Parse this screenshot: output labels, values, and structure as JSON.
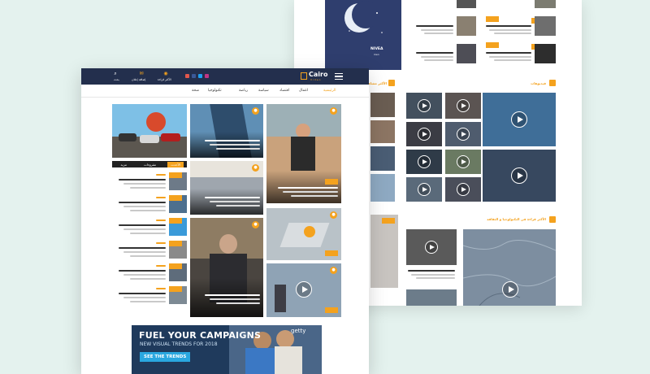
{
  "front": {
    "logo": {
      "main": "Cairo",
      "sub": "Video"
    },
    "topbar": {
      "btn1": "بحث",
      "btn2": "إضافة إعلان",
      "btn3": "الأكثر قراءة"
    },
    "menu": [
      "الرئيسية",
      "اعمال",
      "اقتصاد",
      "سياسة",
      "رياضة",
      "تكنولوجيا",
      "صحة"
    ],
    "side_tabs": [
      "الأحدث",
      "مقروءات",
      "مزيد"
    ],
    "banner": {
      "headline": "FUEL YOUR CAMPAIGNS",
      "subline": "NEW VISUAL TRENDS FOR 2018",
      "cta": "SEE THE TRENDS",
      "brand": "getty"
    }
  },
  "back": {
    "ad_brand": "NIVEA",
    "ad_sub": "men",
    "section_title": "فيديوهات",
    "section_title_right": "الأكثر مشاهدة",
    "section2_title": "الأكثر قراءة في التكنولوجيا و الثقافة"
  },
  "colors": {
    "accent": "#f4a21e",
    "navy": "#232f4d"
  }
}
